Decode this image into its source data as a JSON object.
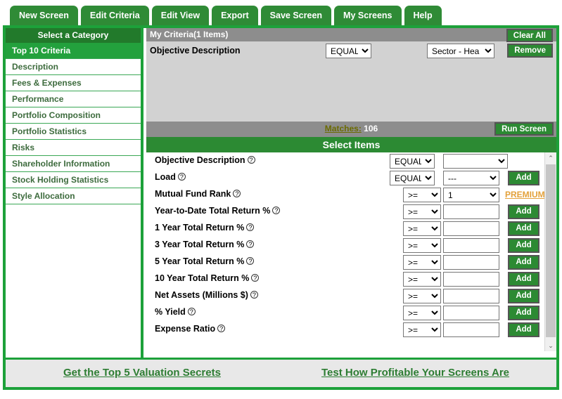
{
  "tabs": [
    {
      "label": "New Screen"
    },
    {
      "label": "Edit Criteria"
    },
    {
      "label": "Edit View"
    },
    {
      "label": "Export"
    },
    {
      "label": "Save Screen"
    },
    {
      "label": "My Screens"
    },
    {
      "label": "Help"
    }
  ],
  "sidebar": {
    "header": "Select a Category",
    "items": [
      {
        "label": "Top 10 Criteria",
        "selected": true
      },
      {
        "label": "Description",
        "selected": false
      },
      {
        "label": "Fees & Expenses",
        "selected": false
      },
      {
        "label": "Performance",
        "selected": false
      },
      {
        "label": "Portfolio Composition",
        "selected": false
      },
      {
        "label": "Portfolio Statistics",
        "selected": false
      },
      {
        "label": "Risks",
        "selected": false
      },
      {
        "label": "Shareholder Information",
        "selected": false
      },
      {
        "label": "Stock Holding Statistics",
        "selected": false
      },
      {
        "label": "Style Allocation",
        "selected": false
      }
    ]
  },
  "criteria_panel": {
    "title": "My Criteria(1 Items)",
    "clear_all_label": "Clear All",
    "row": {
      "label": "Objective Description",
      "operator": "EQUAL",
      "value": "Sector - Hea",
      "remove_label": "Remove"
    }
  },
  "matches": {
    "link_label": "Matches:",
    "count": "106",
    "run_screen_label": "Run Screen"
  },
  "select_items": {
    "header": "Select Items",
    "help_glyph": "?",
    "add_label": "Add",
    "premium_label": "PREMIUM",
    "rows": [
      {
        "label": "Objective Description",
        "operator": "EQUAL",
        "value": "",
        "value_type": "select",
        "value_wide": true,
        "op_wide": true,
        "action": "none"
      },
      {
        "label": "Load",
        "operator": "EQUAL",
        "value": "---",
        "value_type": "select",
        "value_wide": false,
        "op_wide": true,
        "action": "add"
      },
      {
        "label": "Mutual Fund Rank",
        "operator": ">=",
        "value": "1",
        "value_type": "select",
        "value_wide": false,
        "op_wide": false,
        "action": "premium"
      },
      {
        "label": "Year-to-Date Total Return %",
        "operator": ">=",
        "value": "",
        "value_type": "input",
        "value_wide": false,
        "op_wide": false,
        "action": "add"
      },
      {
        "label": "1 Year Total Return %",
        "operator": ">=",
        "value": "",
        "value_type": "input",
        "value_wide": false,
        "op_wide": false,
        "action": "add"
      },
      {
        "label": "3 Year Total Return %",
        "operator": ">=",
        "value": "",
        "value_type": "input",
        "value_wide": false,
        "op_wide": false,
        "action": "add"
      },
      {
        "label": "5 Year Total Return %",
        "operator": ">=",
        "value": "",
        "value_type": "input",
        "value_wide": false,
        "op_wide": false,
        "action": "add"
      },
      {
        "label": "10 Year Total Return %",
        "operator": ">=",
        "value": "",
        "value_type": "input",
        "value_wide": false,
        "op_wide": false,
        "action": "add"
      },
      {
        "label": "Net Assets (Millions $)",
        "operator": ">=",
        "value": "",
        "value_type": "input",
        "value_wide": false,
        "op_wide": false,
        "action": "add"
      },
      {
        "label": "% Yield",
        "operator": ">=",
        "value": "",
        "value_type": "input",
        "value_wide": false,
        "op_wide": false,
        "action": "add"
      },
      {
        "label": "Expense Ratio",
        "operator": ">=",
        "value": "",
        "value_type": "input",
        "value_wide": false,
        "op_wide": false,
        "action": "add"
      }
    ]
  },
  "scrollbar": {
    "up_glyph": "⌃",
    "down_glyph": "⌄"
  },
  "bottom_links": [
    {
      "label": "Get the Top 5 Valuation Secrets"
    },
    {
      "label": "Test How Profitable Your Screens Are"
    }
  ],
  "colors": {
    "frame_green": "#1da13a",
    "tab_green": "#2f8b36",
    "header_green": "#227a2b",
    "selected_green": "#23a13d",
    "panel_gray": "#d2d2d2",
    "title_gray": "#8d8d8d",
    "premium_orange": "#e3a13a"
  }
}
